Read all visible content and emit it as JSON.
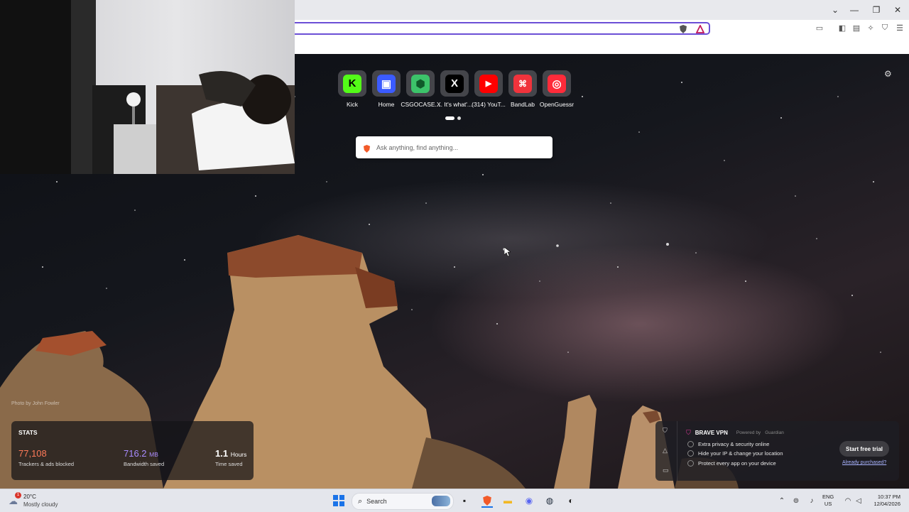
{
  "browser": {
    "window_controls": [
      "⌄",
      "—",
      "❐",
      "✕"
    ]
  },
  "top_sites": [
    {
      "label": "Kick",
      "glyph": "K",
      "bg": "#53fc18",
      "fg": "#000"
    },
    {
      "label": "Home",
      "glyph": "▣",
      "bg": "#3b5bff",
      "fg": "#fff"
    },
    {
      "label": "CSGOCASE...",
      "glyph": "⬢",
      "bg": "#3cc36a",
      "fg": "#0f5a2a"
    },
    {
      "label": "X. It's what'...",
      "glyph": "X",
      "bg": "#000",
      "fg": "#fff"
    },
    {
      "label": "(314) YouT...",
      "glyph": "▶",
      "bg": "#ff0000",
      "fg": "#fff"
    },
    {
      "label": "BandLab",
      "glyph": "⌘",
      "bg": "#f0333c",
      "fg": "#fff"
    },
    {
      "label": "OpenGuessr",
      "glyph": "◎",
      "bg": "#ff2b3a",
      "fg": "#fff"
    }
  ],
  "search": {
    "placeholder": "Ask anything, find anything..."
  },
  "photo_credit": "Photo by John Fowler",
  "stats": {
    "title": "STATS",
    "items": [
      {
        "value": "77,108",
        "unit": "",
        "label": "Trackers & ads blocked",
        "color": "#ff7a59"
      },
      {
        "value": "716.2",
        "unit": "MB",
        "label": "Bandwidth saved",
        "color": "#a88bff"
      },
      {
        "value": "1.1",
        "unit": "Hours",
        "label": "Time saved",
        "color": "#ffffff"
      }
    ]
  },
  "vpn": {
    "title": "BRAVE VPN",
    "powered_by": "Powered by",
    "partner": "Guardian",
    "features": [
      "Extra privacy & security online",
      "Hide your IP & change your location",
      "Protect every app on your device"
    ],
    "cta": "Start free trial",
    "link": "Already purchased?"
  },
  "taskbar": {
    "weather_temp": "20°C",
    "weather_desc": "Mostly cloudy",
    "weather_badge": "1",
    "search_label": "Search",
    "lang": "ENG",
    "region": "US",
    "time": "10:37 PM",
    "date": "12/04/2026"
  }
}
